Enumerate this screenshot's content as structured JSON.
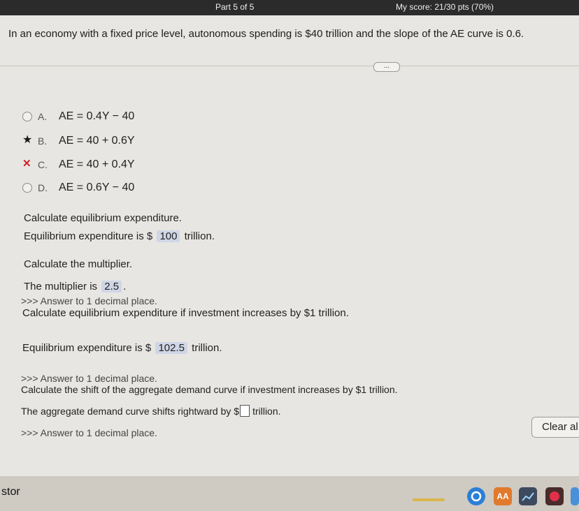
{
  "header": {
    "part": "Part 5 of 5",
    "score": "My score: 21/30 pts (70%)"
  },
  "question": "In an economy with a fixed price level, autonomous spending is $40 trillion and the slope of the AE curve is 0.6.",
  "more_button": "...",
  "options": [
    {
      "letter": "A.",
      "equation": "AE = 0.4Y − 40",
      "state": "unselected"
    },
    {
      "letter": "B.",
      "equation": "AE = 40 + 0.6Y",
      "state": "correct"
    },
    {
      "letter": "C.",
      "equation": "AE = 40 + 0.4Y",
      "state": "incorrect"
    },
    {
      "letter": "D.",
      "equation": "AE = 0.6Y − 40",
      "state": "unselected"
    }
  ],
  "q1": {
    "prompt": "Calculate equilibrium expenditure.",
    "prefix": "Equilibrium expenditure is $",
    "answer": "100",
    "suffix": "trillion."
  },
  "q2": {
    "prompt": "Calculate the multiplier.",
    "prefix": "The multiplier is",
    "answer": "2.5",
    "suffix": ".",
    "hint": ">>> Answer to 1 decimal place."
  },
  "q3": {
    "prompt": "Calculate equilibrium expenditure if investment increases by $1 trillion.",
    "prefix": "Equilibrium expenditure is $",
    "answer": "102.5",
    "suffix": "trillion.",
    "hint": ">>> Answer to 1 decimal place."
  },
  "q4": {
    "prompt": "Calculate the shift of the aggregate demand curve if investment increases by $1 trillion.",
    "prefix": "The aggregate demand curve shifts rightward by $",
    "answer": "",
    "suffix": "trillion.",
    "hint": ">>> Answer to 1 decimal place."
  },
  "clear_button": "Clear al",
  "taskbar": {
    "label": "stor",
    "icon_text": "AA"
  }
}
